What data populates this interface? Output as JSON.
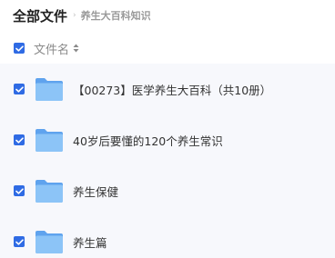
{
  "breadcrumb": {
    "root": "全部文件",
    "separator": "›",
    "current": "养生大百科知识"
  },
  "list_header": {
    "name_label": "文件名",
    "all_selected": true
  },
  "files": [
    {
      "name": "【00273】医学养生大百科（共10册）",
      "type": "folder",
      "selected": true
    },
    {
      "name": "40岁后要懂的120个养生常识",
      "type": "folder",
      "selected": true
    },
    {
      "name": "养生保健",
      "type": "folder",
      "selected": true
    },
    {
      "name": "养生篇",
      "type": "folder",
      "selected": true
    }
  ],
  "colors": {
    "accent": "#2f6be4",
    "row_background": "#f7f8fc",
    "folder": "#7fb8f5"
  },
  "icons": {
    "checkbox": "checkbox-checked-icon",
    "folder": "folder-icon",
    "sort": "sort-icon",
    "separator": "chevron-right-icon"
  }
}
